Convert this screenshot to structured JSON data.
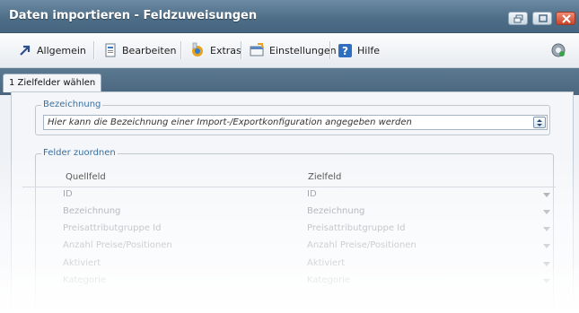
{
  "window": {
    "title": "Daten importieren - Feldzuweisungen"
  },
  "toolbar": {
    "items": [
      {
        "label": "Allgemein",
        "icon": "arrow-icon"
      },
      {
        "label": "Bearbeiten",
        "icon": "document-icon"
      },
      {
        "label": "Extras",
        "icon": "extras-icon"
      },
      {
        "label": "Einstellungen",
        "icon": "settings-icon"
      },
      {
        "label": "Hilfe",
        "icon": "help-icon"
      }
    ]
  },
  "tabs": [
    {
      "label": "1 Zielfelder wählen",
      "selected": true
    }
  ],
  "bezeichnung": {
    "title": "Bezeichnung",
    "placeholder": "Hier kann die Bezeichnung einer Import-/Exportkonfiguration angegeben werden"
  },
  "felder": {
    "title": "Felder zuordnen",
    "columns": [
      "Quellfeld",
      "Zielfeld"
    ],
    "rows": [
      {
        "quellfeld": "ID",
        "zielfeld": "ID"
      },
      {
        "quellfeld": "Bezeichnung",
        "zielfeld": "Bezeichnung"
      },
      {
        "quellfeld": "Preisattributgruppe Id",
        "zielfeld": "Preisattributgruppe Id"
      },
      {
        "quellfeld": "Anzahl Preise/Positionen",
        "zielfeld": "Anzahl Preise/Positionen"
      },
      {
        "quellfeld": "Aktiviert",
        "zielfeld": "Aktiviert"
      },
      {
        "quellfeld": "Kategorie",
        "zielfeld": "Kategorie"
      }
    ]
  },
  "colors": {
    "titlebar": "#4f6e88",
    "accent": "#3a6f9f"
  }
}
